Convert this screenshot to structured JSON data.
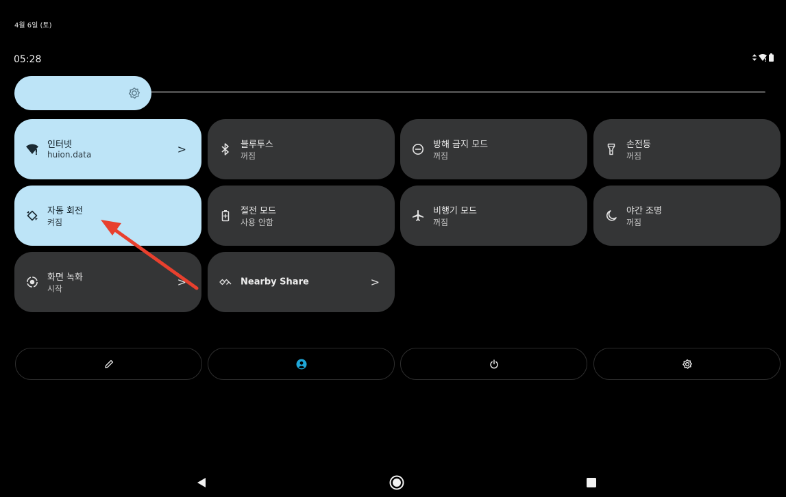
{
  "status_bar": {
    "date": "4월 6일 (토)",
    "time": "05:28",
    "icons": [
      "data-arrows-icon",
      "wifi-icon",
      "battery-icon"
    ]
  },
  "brightness": {
    "level": 0.2,
    "icon": "brightness-gear-icon"
  },
  "tiles": [
    {
      "label": "인터넷",
      "sub": "huion.data",
      "icon": "wifi-icon",
      "on": true,
      "chevron": ">"
    },
    {
      "label": "블루투스",
      "sub": "꺼짐",
      "icon": "bluetooth-icon",
      "on": false
    },
    {
      "label": "방해 금지 모드",
      "sub": "꺼짐",
      "icon": "do-not-disturb-icon",
      "on": false
    },
    {
      "label": "손전등",
      "sub": "꺼짐",
      "icon": "flashlight-icon",
      "on": false
    },
    {
      "label": "자동 회전",
      "sub": "켜짐",
      "icon": "auto-rotate-icon",
      "on": true
    },
    {
      "label": "절전 모드",
      "sub": "사용 안함",
      "icon": "battery-saver-icon",
      "on": false
    },
    {
      "label": "비행기 모드",
      "sub": "꺼짐",
      "icon": "airplane-icon",
      "on": false
    },
    {
      "label": "야간 조명",
      "sub": "꺼짐",
      "icon": "moon-icon",
      "on": false
    },
    {
      "label": "화면 녹화",
      "sub": "시작",
      "icon": "screen-record-icon",
      "on": false,
      "chevron": ">"
    },
    {
      "label": "Nearby Share",
      "icon": "nearby-share-icon",
      "on": false,
      "chevron": ">"
    }
  ],
  "footer": {
    "buttons": [
      "edit-pencil-icon",
      "user-account-icon",
      "power-icon",
      "settings-gear-icon"
    ],
    "accent": "#1fa7d8"
  },
  "nav": [
    "back-icon",
    "home-icon",
    "recents-icon"
  ],
  "colors": {
    "background": "#000000",
    "tile_off": "#343536",
    "tile_on": "#bde4f7",
    "annotation_arrow": "#e8402e"
  }
}
